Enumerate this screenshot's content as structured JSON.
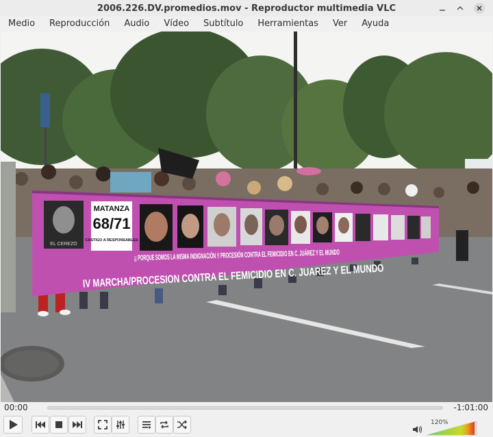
{
  "window": {
    "title": "2006.226.DV.promedios.mov - Reproductor multimedia VLC"
  },
  "menu": [
    "Medio",
    "Reproducción",
    "Audio",
    "Vídeo",
    "Subtítulo",
    "Herramientas",
    "Ver",
    "Ayuda"
  ],
  "video": {
    "banner_sign_line1": "MATANZA",
    "banner_sign_line2": "68/71",
    "banner_sign_line3": "CASTIGO A RESPONSABLES",
    "banner_caption_1": "¡¡ PORQUE SOMOS LA MISMA INDIGNACIÓN !! PROCESIÓN CONTRA EL FEMICIDIO EN C. JUÁREZ Y EL MUNDO",
    "banner_caption_2": "IV MARCHA/PROCESION CONTRA EL FEMICIDIO EN C. JUAREZ Y EL MUNDO",
    "photo_caption": "EL CEREZO"
  },
  "playback": {
    "elapsed": "00:00",
    "remaining": "-1:01:00",
    "progress": 0.0,
    "volume_label": "120%",
    "volume_level": 1.2
  },
  "colors": {
    "banner": "#c050b0",
    "volume_green": "#4cc43c",
    "volume_red": "#e03a1a"
  }
}
